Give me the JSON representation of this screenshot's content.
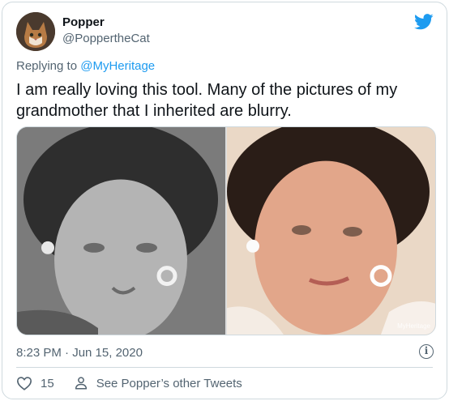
{
  "author": {
    "name": "Popper",
    "handle": "@PoppertheCat"
  },
  "reply_to": {
    "prefix": "Replying to",
    "handle": "@MyHeritage"
  },
  "tweet_text": "I am really loving this tool. Many of the pictures of my grandmother that I inherited are blurry.",
  "media": {
    "watermark": "MyHeritage"
  },
  "timestamp": "8:23 PM · Jun 15, 2020",
  "actions": {
    "like_count": "15",
    "other_tweets_label": "See Popper’s other Tweets"
  },
  "colors": {
    "accent": "#1d9bf0",
    "muted": "#536471",
    "border": "#cfd9de"
  },
  "icons": {
    "brand": "twitter-bird-icon",
    "like": "heart-icon",
    "profile": "person-icon",
    "info": "info-icon"
  }
}
